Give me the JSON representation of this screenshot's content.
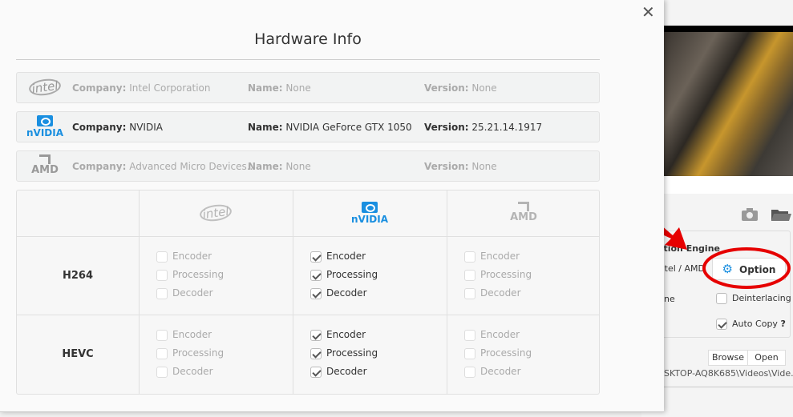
{
  "dialog": {
    "title": "Hardware Info",
    "close_icon": "close-icon"
  },
  "gpus": [
    {
      "logo": "intel",
      "company_label": "Company:",
      "company": "Intel Corporation",
      "name_label": "Name:",
      "name": "None",
      "version_label": "Version:",
      "version": "None",
      "active": false
    },
    {
      "logo": "nvidia",
      "company_label": "Company:",
      "company": "NVIDIA",
      "name_label": "Name:",
      "name": "NVIDIA GeForce GTX 1050",
      "version_label": "Version:",
      "version": "25.21.14.1917",
      "active": true
    },
    {
      "logo": "amd",
      "company_label": "Company:",
      "company": "Advanced Micro Devices...",
      "name_label": "Name:",
      "name": "None",
      "version_label": "Version:",
      "version": "None",
      "active": false
    }
  ],
  "logos": {
    "intel": "intel",
    "nvidia": "nVIDIA",
    "amd": "AMD"
  },
  "table": {
    "rows": [
      {
        "codec": "H264",
        "cols": [
          {
            "vendor": "intel",
            "items": [
              {
                "label": "Encoder",
                "checked": false
              },
              {
                "label": "Processing",
                "checked": false
              },
              {
                "label": "Decoder",
                "checked": false
              }
            ]
          },
          {
            "vendor": "nvidia",
            "items": [
              {
                "label": "Encoder",
                "checked": true
              },
              {
                "label": "Processing",
                "checked": true
              },
              {
                "label": "Decoder",
                "checked": true
              }
            ]
          },
          {
            "vendor": "amd",
            "items": [
              {
                "label": "Encoder",
                "checked": false
              },
              {
                "label": "Processing",
                "checked": false
              },
              {
                "label": "Decoder",
                "checked": false
              }
            ]
          }
        ]
      },
      {
        "codec": "HEVC",
        "cols": [
          {
            "vendor": "intel",
            "items": [
              {
                "label": "Encoder",
                "checked": false
              },
              {
                "label": "Processing",
                "checked": false
              },
              {
                "label": "Decoder",
                "checked": false
              }
            ]
          },
          {
            "vendor": "nvidia",
            "items": [
              {
                "label": "Encoder",
                "checked": true
              },
              {
                "label": "Processing",
                "checked": true
              },
              {
                "label": "Decoder",
                "checked": true
              }
            ]
          },
          {
            "vendor": "amd",
            "items": [
              {
                "label": "Encoder",
                "checked": false
              },
              {
                "label": "Processing",
                "checked": false
              },
              {
                "label": "Decoder",
                "checked": false
              }
            ]
          }
        ]
      }
    ]
  },
  "app": {
    "engine_label": "Acceleration Engine:",
    "engine_value": "Intel / AMD",
    "option_button": "Option",
    "partial_label": "ne",
    "deinterlacing": {
      "label": "Deinterlacing",
      "checked": false
    },
    "auto_copy": {
      "label": "Auto Copy",
      "checked": true,
      "help": "?"
    },
    "browse_button": "Browse",
    "open_button": "Open",
    "output_path": "SKTOP-AQ8K685\\Videos\\Vide...",
    "accent": "#1a8fe0",
    "annotation_color": "#e60000"
  }
}
